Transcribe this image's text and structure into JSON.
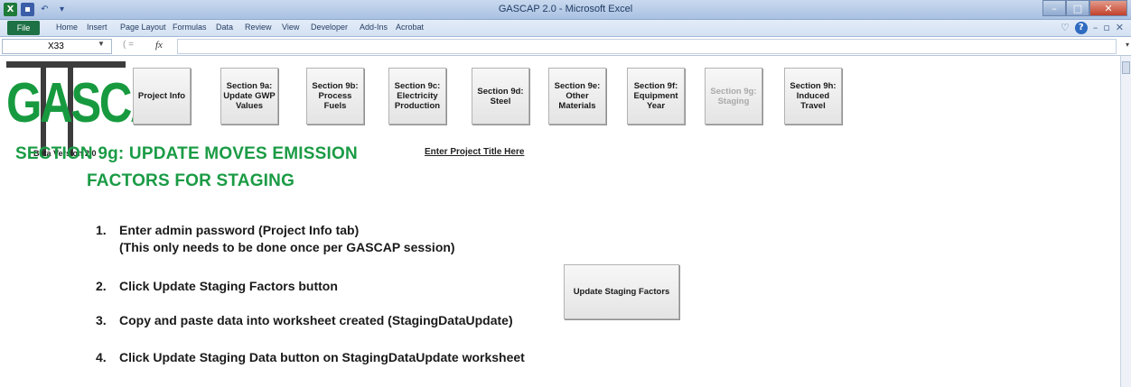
{
  "window": {
    "title": "GASCAP 2.0 - Microsoft Excel",
    "qat_icons": [
      "excel-icon",
      "save-icon",
      "undo-icon",
      "qat-more-icon"
    ],
    "controls": [
      "minimize",
      "maximize",
      "close"
    ]
  },
  "ribbon": {
    "file_tab": "File",
    "tabs": [
      "Home",
      "Insert",
      "Page Layout",
      "Formulas",
      "Data",
      "Review",
      "View",
      "Developer",
      "Add-Ins",
      "Acrobat"
    ]
  },
  "formula_bar": {
    "name_box": "X33",
    "fx_label": "fx",
    "value": ""
  },
  "logo": {
    "text": "GASCAP",
    "version": "Beta Version 2.0",
    "accent_color": "#179a3f"
  },
  "nav_buttons": [
    {
      "label": "Project Info",
      "enabled": true
    },
    {
      "label": "Section 9a: Update GWP Values",
      "enabled": true
    },
    {
      "label": "Section 9b: Process Fuels",
      "enabled": true
    },
    {
      "label": "Section 9c: Electricity Production",
      "enabled": true
    },
    {
      "label": "Section 9d: Steel",
      "enabled": true
    },
    {
      "label": "Section 9e: Other Materials",
      "enabled": true
    },
    {
      "label": "Section 9f: Equipment Year",
      "enabled": true
    },
    {
      "label": "Section 9g: Staging",
      "enabled": false
    },
    {
      "label": "Section 9h: Induced Travel",
      "enabled": true
    }
  ],
  "heading": {
    "line1": "SECTION 9g: UPDATE MOVES EMISSION",
    "line2": "FACTORS FOR STAGING",
    "color": "#1a9b45"
  },
  "project_title_link": "Enter Project Title Here",
  "steps": [
    {
      "num": "1.",
      "text": "Enter admin password (Project Info tab)",
      "sub": "(This only needs to be done once per GASCAP session)"
    },
    {
      "num": "2.",
      "text": "Click Update Staging Factors button",
      "sub": ""
    },
    {
      "num": "3.",
      "text": "Copy and paste data into worksheet created (StagingDataUpdate)",
      "sub": ""
    },
    {
      "num": "4.",
      "text": "Click Update Staging Data button on StagingDataUpdate worksheet",
      "sub": ""
    }
  ],
  "action_button": {
    "label": "Update Staging Factors"
  }
}
